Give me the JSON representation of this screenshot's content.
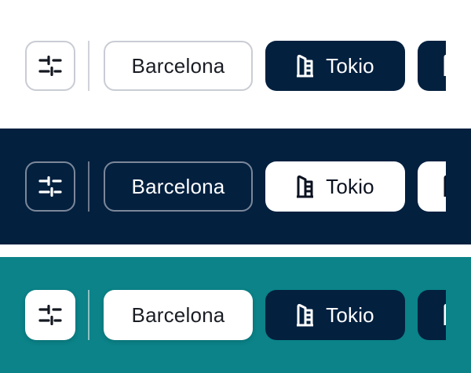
{
  "chips": {
    "filter_label": "",
    "barcelona_label": "Barcelona",
    "tokio_label": "Tokio",
    "next_label": ""
  },
  "icons": {
    "filter": "sliders-icon",
    "tokio": "building-icon"
  },
  "themes": {
    "light": {
      "background": "#ffffff",
      "selected": "#03203f"
    },
    "dark": {
      "background": "#03203f",
      "selected": "#ffffff"
    },
    "teal": {
      "background": "#0b8388",
      "selected": "#03203f"
    }
  }
}
